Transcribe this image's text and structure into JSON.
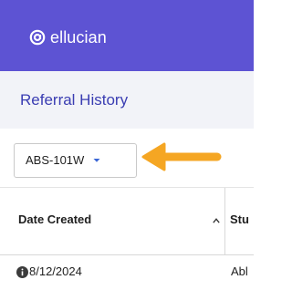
{
  "header": {
    "logo_text": "ellucian",
    "logo_icon": "ellucian-logo-icon",
    "background_color": "#5d53d3"
  },
  "subheader": {
    "title": "Referral History",
    "title_color": "#3a3db2",
    "background_color": "#f2f3f8"
  },
  "filter": {
    "selected_value": "ABS-101W",
    "caret_icon": "caret-down-icon"
  },
  "annotation": {
    "arrow_icon": "pointer-arrow-left-icon",
    "arrow_color": "#f5a623"
  },
  "table": {
    "columns": [
      {
        "label": "Date Created",
        "sort_icon": "chevron-up-icon"
      },
      {
        "label": "Stu"
      }
    ],
    "rows": [
      {
        "info_icon": "info-icon",
        "date": "8/12/2024",
        "student": "Abl"
      }
    ]
  }
}
